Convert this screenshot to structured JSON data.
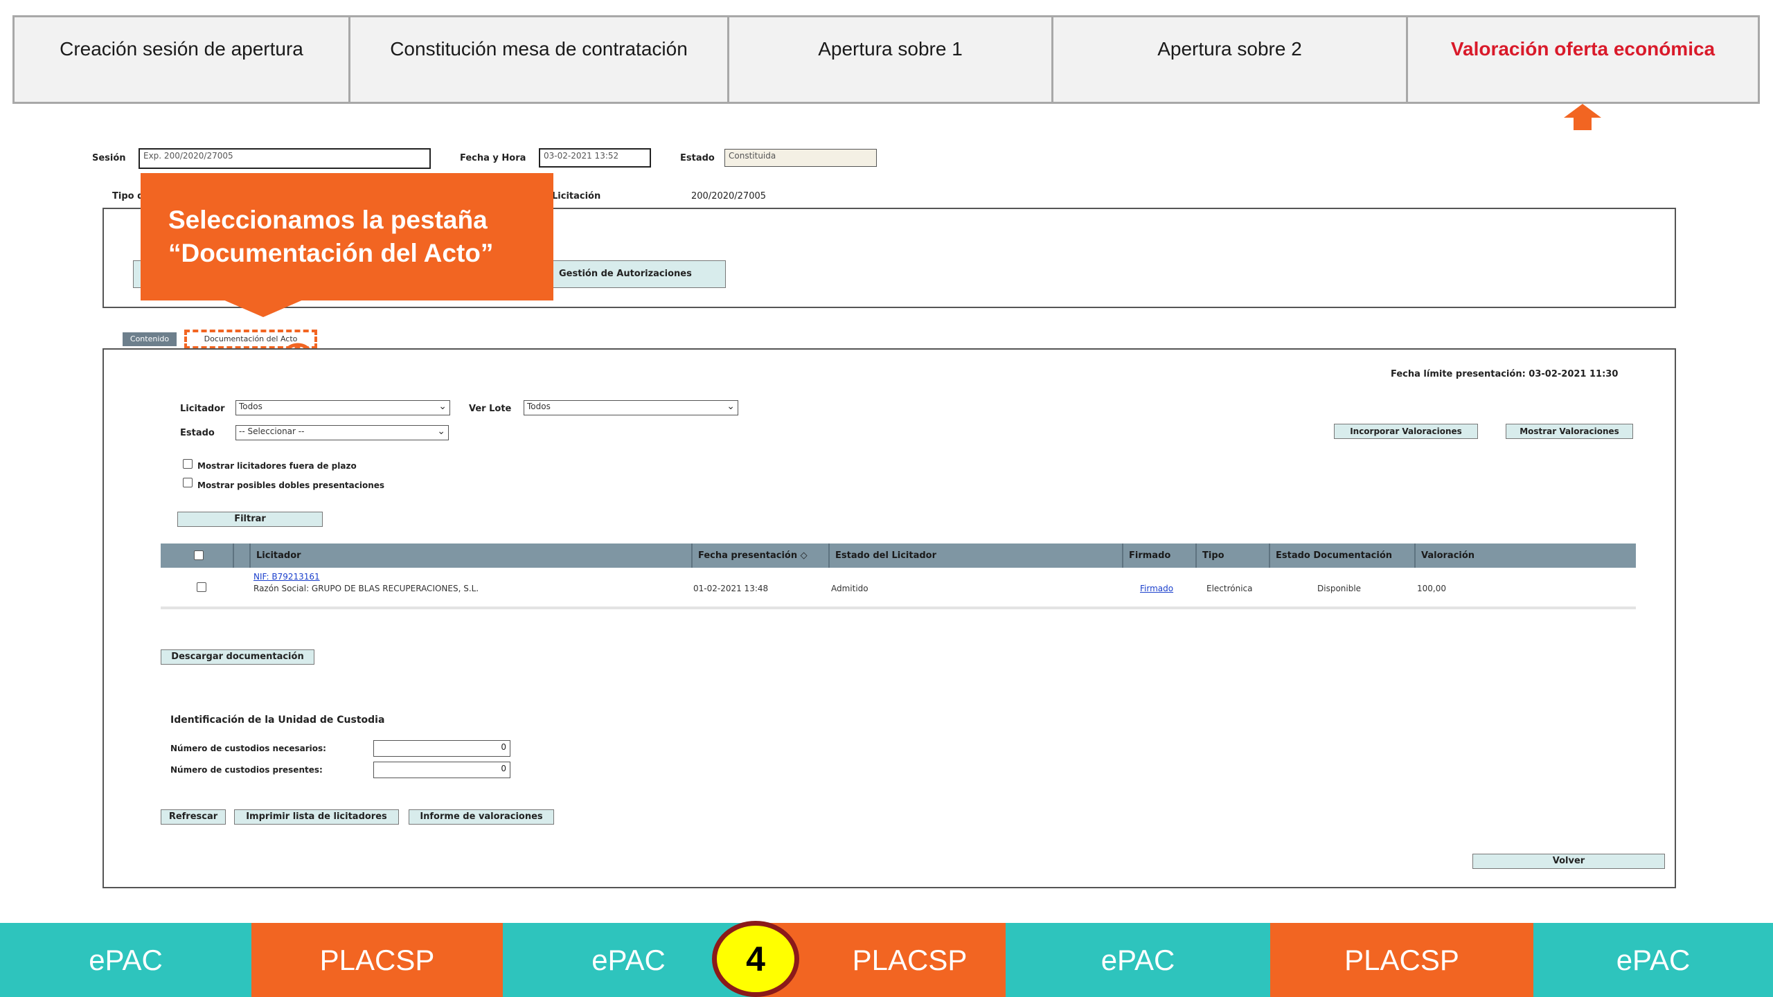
{
  "steps": [
    {
      "label": "Creación sesión de apertura"
    },
    {
      "label": "Constitución mesa de contratación"
    },
    {
      "label": "Apertura sobre 1"
    },
    {
      "label": "Apertura sobre 2"
    },
    {
      "label": "Valoración oferta económica"
    }
  ],
  "colors": {
    "active_step": "#d91a2a",
    "accent_orange": "#f26522",
    "teal": "#2ec4bd",
    "badge_yellow": "#ffff00",
    "badge_ring": "#8b1a1a"
  },
  "session": {
    "sesion_label": "Sesión",
    "sesion_value": "Exp. 200/2020/27005",
    "fecha_label": "Fecha y Hora",
    "fecha_value": "03-02-2021 13:52",
    "estado_label": "Estado",
    "estado_value": "Constituida",
    "tipo_label": "Tipo d",
    "licitacion_label": "Licitación",
    "licitacion_value": "200/2020/27005"
  },
  "gestion_button": "Gestión de Autorizaciones",
  "callout": {
    "line1": "Seleccionamos la pestaña",
    "line2": "“Documentación del Acto”"
  },
  "tabs": {
    "contenido": "Contenido",
    "documentacion": "Documentación del Acto"
  },
  "fecha_limite": "Fecha límite presentación: 03-02-2021 11:30",
  "filters": {
    "licitador_label": "Licitador",
    "licitador_value": "Todos",
    "ver_lote_label": "Ver Lote",
    "ver_lote_value": "Todos",
    "estado_label": "Estado",
    "estado_value": "-- Seleccionar --",
    "chk_fuera_plazo": "Mostrar licitadores fuera de plazo",
    "chk_dobles": "Mostrar posibles dobles presentaciones",
    "filtrar_button": "Filtrar"
  },
  "actions": {
    "incorporar": "Incorporar Valoraciones",
    "mostrar": "Mostrar Valoraciones"
  },
  "table": {
    "headers": [
      "Licitador",
      "Fecha presentación ◇",
      "Estado del Licitador",
      "Firmado",
      "Tipo",
      "Estado Documentación",
      "Valoración"
    ],
    "rows": [
      {
        "nif": "NIF: B79213161",
        "razon": "Razón Social: GRUPO DE BLAS RECUPERACIONES, S.L.",
        "fecha": "01-02-2021 13:48",
        "estado": "Admitido",
        "firmado": "Firmado",
        "tipo": "Electrónica",
        "estado_doc": "Disponible",
        "valoracion": "100,00"
      }
    ]
  },
  "descargar_button": "Descargar documentación",
  "custodia": {
    "title": "Identificación de la Unidad de Custodia",
    "necesarios_label": "Número de custodios necesarios:",
    "necesarios_value": "0",
    "presentes_label": "Número de custodios presentes:",
    "presentes_value": "0"
  },
  "bottom_buttons": {
    "refrescar": "Refrescar",
    "imprimir": "Imprimir lista de licitadores",
    "informe": "Informe de valoraciones",
    "volver": "Volver"
  },
  "bottom_bar": [
    "ePAC",
    "PLACSP",
    "ePAC",
    "PLACSP",
    "ePAC",
    "PLACSP",
    "ePAC"
  ],
  "step_badge": "4"
}
